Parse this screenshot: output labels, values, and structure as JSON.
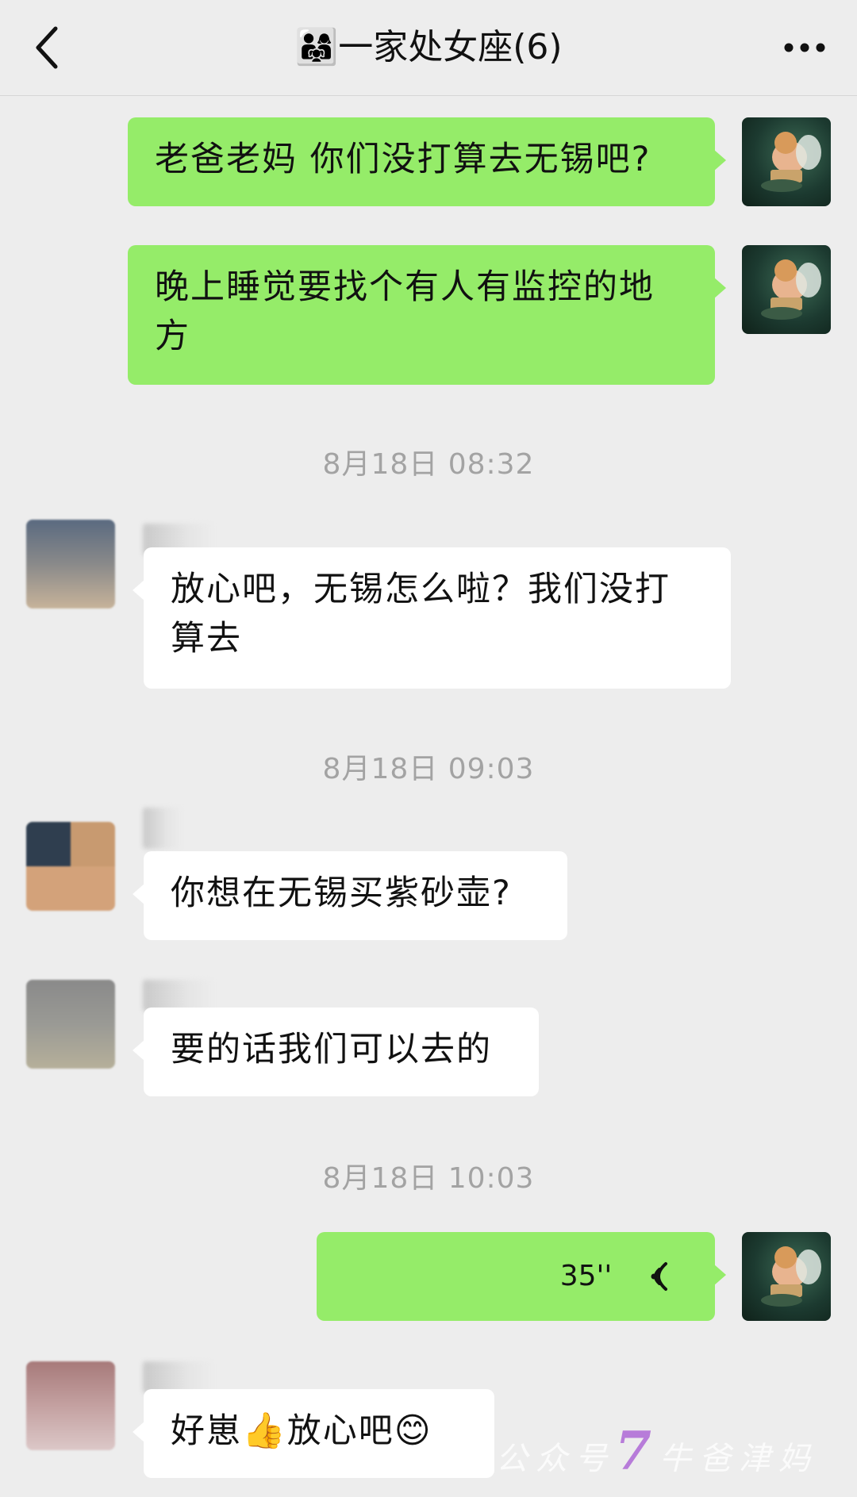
{
  "header": {
    "title_emoji": "👨‍👩‍👧",
    "title": "一家处女座(6)",
    "back_icon": "chevron-left-icon",
    "more_icon": "more-dots-icon"
  },
  "messages": [
    {
      "kind": "out",
      "text": "老爸老妈 你们没打算去无锡吧?"
    },
    {
      "kind": "out",
      "text": "晚上睡觉要找个有人有监控的地方"
    },
    {
      "kind": "time",
      "text": "8月18日 08:32"
    },
    {
      "kind": "in",
      "text": "放心吧，无锡怎么啦？我们没打算去"
    },
    {
      "kind": "time",
      "text": "8月18日 09:03"
    },
    {
      "kind": "in",
      "text": "你想在无锡买紫砂壶?"
    },
    {
      "kind": "in",
      "text": "要的话我们可以去的"
    },
    {
      "kind": "time",
      "text": "8月18日 10:03"
    },
    {
      "kind": "out-voice",
      "duration": "35''",
      "icon": "voice-wave-icon"
    },
    {
      "kind": "in",
      "text_before": "好崽",
      "emoji_1": "👍",
      "text_after": "放心吧",
      "emoji_2": "😊"
    }
  ],
  "watermark": {
    "prefix": "公众号",
    "seven": "7",
    "suffix": "牛爸津妈"
  },
  "colors": {
    "out_bubble": "#95ec69",
    "in_bubble": "#ffffff",
    "background": "#ededed",
    "timestamp": "#a3a3a3"
  }
}
